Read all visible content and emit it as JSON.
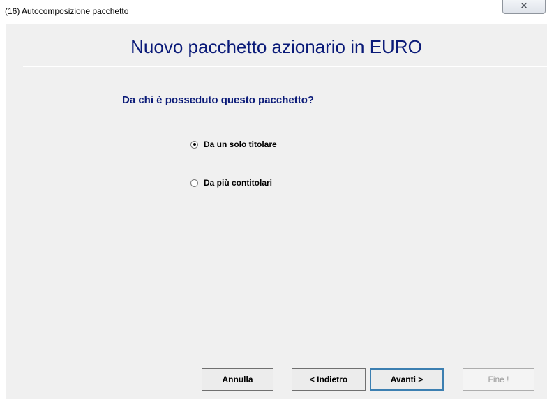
{
  "window": {
    "title": "(16) Autocomposizione pacchetto",
    "close_icon": "close-icon"
  },
  "main": {
    "heading": "Nuovo pacchetto azionario in EURO",
    "question": "Da chi è posseduto questo pacchetto?",
    "options": [
      {
        "label": "Da un solo titolare",
        "selected": true
      },
      {
        "label": "Da più contitolari",
        "selected": false
      }
    ]
  },
  "buttons": {
    "cancel": {
      "label": "Annulla",
      "enabled": true
    },
    "back": {
      "label": "< Indietro",
      "enabled": true
    },
    "next": {
      "label": "Avanti >",
      "enabled": true,
      "default": true
    },
    "finish": {
      "label": "Fine !",
      "enabled": false
    }
  },
  "colors": {
    "heading": "#0a1a78",
    "client_background": "#f0f0f0",
    "default_button_border": "#3c7fb1"
  }
}
